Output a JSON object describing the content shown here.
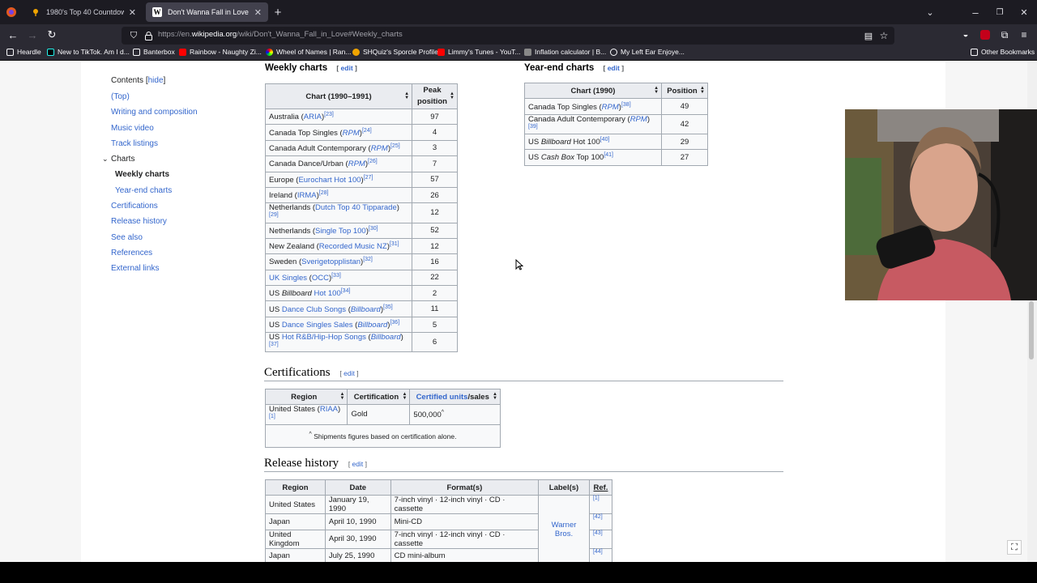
{
  "tabs": [
    {
      "title": "1980's Top 40 Countdown (clip",
      "favicon": "pin-icon",
      "active": false
    },
    {
      "title": "Don't Wanna Fall in Love - Wiki",
      "favicon": "wikipedia-icon",
      "active": true
    }
  ],
  "url": {
    "prefix": "https://en.",
    "domain": "wikipedia.org",
    "path": "/wiki/Don't_Wanna_Fall_in_Love#Weekly_charts"
  },
  "bookmarks": [
    {
      "label": "Heardle"
    },
    {
      "label": "New to TikTok. Am I d..."
    },
    {
      "label": "Banterbox"
    },
    {
      "label": "Rainbow - Naughty Zi..."
    },
    {
      "label": "Wheel of Names | Ran..."
    },
    {
      "label": "SHQuiz's Sporcle Profile"
    },
    {
      "label": "Limmy's Tunes - YouT..."
    },
    {
      "label": "Inflation calculator | B..."
    },
    {
      "label": "My Left Ear Enjoye..."
    },
    {
      "label": "Other Bookmarks"
    }
  ],
  "toc": {
    "title": "Contents",
    "hide": "hide",
    "items": [
      {
        "label": "(Top)"
      },
      {
        "label": "Writing and composition"
      },
      {
        "label": "Music video"
      },
      {
        "label": "Track listings"
      },
      {
        "label": "Charts"
      },
      {
        "label": "Weekly charts"
      },
      {
        "label": "Year-end charts"
      },
      {
        "label": "Certifications"
      },
      {
        "label": "Release history"
      },
      {
        "label": "See also"
      },
      {
        "label": "References"
      },
      {
        "label": "External links"
      }
    ]
  },
  "edit_label": "edit",
  "weekly": {
    "heading": "Weekly charts",
    "col1": "Chart (1990–1991)",
    "col2a": "Peak",
    "col2b": "position",
    "rows": [
      {
        "pre": "Australia (",
        "link": "ARIA",
        "post": ")",
        "ref": "[23]",
        "pos": "97"
      },
      {
        "pre": "Canada Top Singles (",
        "link": "RPM",
        "post": ")",
        "ref": "[24]",
        "pos": "4"
      },
      {
        "pre": "Canada Adult Contemporary (",
        "link": "RPM",
        "post": ")",
        "ref": "[25]",
        "pos": "3"
      },
      {
        "pre": "Canada Dance/Urban (",
        "link": "RPM",
        "post": ")",
        "ref": "[26]",
        "pos": "7"
      },
      {
        "pre": "Europe (",
        "link": "Eurochart Hot 100",
        "post": ")",
        "ref": "[27]",
        "pos": "57"
      },
      {
        "pre": "Ireland (",
        "link": "IRMA",
        "post": ")",
        "ref": "[28]",
        "pos": "26"
      },
      {
        "pre": "Netherlands (",
        "link": "Dutch Top 40 Tipparade",
        "post": ")",
        "ref": "[29]",
        "pos": "12"
      },
      {
        "pre": "Netherlands (",
        "link": "Single Top 100",
        "post": ")",
        "ref": "[30]",
        "pos": "52"
      },
      {
        "pre": "New Zealand (",
        "link": "Recorded Music NZ",
        "post": ")",
        "ref": "[31]",
        "pos": "12"
      },
      {
        "pre": "Sweden (",
        "link": "Sverigetopplistan",
        "post": ")",
        "ref": "[32]",
        "pos": "16"
      },
      {
        "pre": "",
        "link": "UK Singles",
        "post": " (OCC)",
        "ref": "[33]",
        "pos": "22"
      },
      {
        "pre": "US ",
        "link": "Billboard",
        "post": " Hot 100",
        "ref": "[34]",
        "pos": "2"
      },
      {
        "pre": "US ",
        "link": "Dance Club Songs",
        "post": " (Billboard)",
        "ref": "[35]",
        "pos": "11"
      },
      {
        "pre": "US ",
        "link": "Dance Singles Sales",
        "post": " (Billboard)",
        "ref": "[36]",
        "pos": "5"
      },
      {
        "pre": "US ",
        "link": "Hot R&B/Hip-Hop Songs",
        "post": " (Billboard)",
        "ref": "[37]",
        "pos": "6"
      }
    ]
  },
  "yearend": {
    "heading": "Year-end charts",
    "col1": "Chart (1990)",
    "col2": "Position",
    "rows": [
      {
        "chart": "Canada Top Singles (RPM)",
        "ref": "[38]",
        "pos": "49"
      },
      {
        "chart": "Canada Adult Contemporary (RPM)",
        "ref": "[39]",
        "pos": "42"
      },
      {
        "chart": "US Billboard Hot 100",
        "ref": "[40]",
        "pos": "29"
      },
      {
        "chart": "US Cash Box Top 100",
        "ref": "[41]",
        "pos": "27"
      }
    ]
  },
  "certs": {
    "heading": "Certifications",
    "cols": [
      "Region",
      "Certification",
      "Certified units",
      "/sales"
    ],
    "row": {
      "region": "United States (",
      "link": "RIAA",
      "post": ")",
      "ref": "[1]",
      "cert": "Gold",
      "units": "500,000",
      "mark": "^"
    },
    "footnote": "Shipments figures based on certification alone.",
    "foot_mark": "^"
  },
  "release": {
    "heading": "Release history",
    "cols": [
      "Region",
      "Date",
      "Format(s)",
      "Label(s)",
      "Ref."
    ],
    "label": "Warner Bros.",
    "rows": [
      {
        "region": "United States",
        "date": "January 19, 1990",
        "format": "7-inch vinyl · 12-inch vinyl · CD · cassette",
        "ref": "[1]"
      },
      {
        "region": "Japan",
        "date": "April 10, 1990",
        "format": "Mini-CD",
        "ref": "[42]"
      },
      {
        "region": "United Kingdom",
        "date": "April 30, 1990",
        "format": "7-inch vinyl · 12-inch vinyl · CD · cassette",
        "ref": "[43]"
      },
      {
        "region": "Japan",
        "date": "July 25, 1990",
        "format": "CD mini-album",
        "ref": "[44]"
      }
    ]
  },
  "colors": {
    "link": "#3366cc",
    "tab_active": "#42414d",
    "chrome": "#2b2a33"
  }
}
